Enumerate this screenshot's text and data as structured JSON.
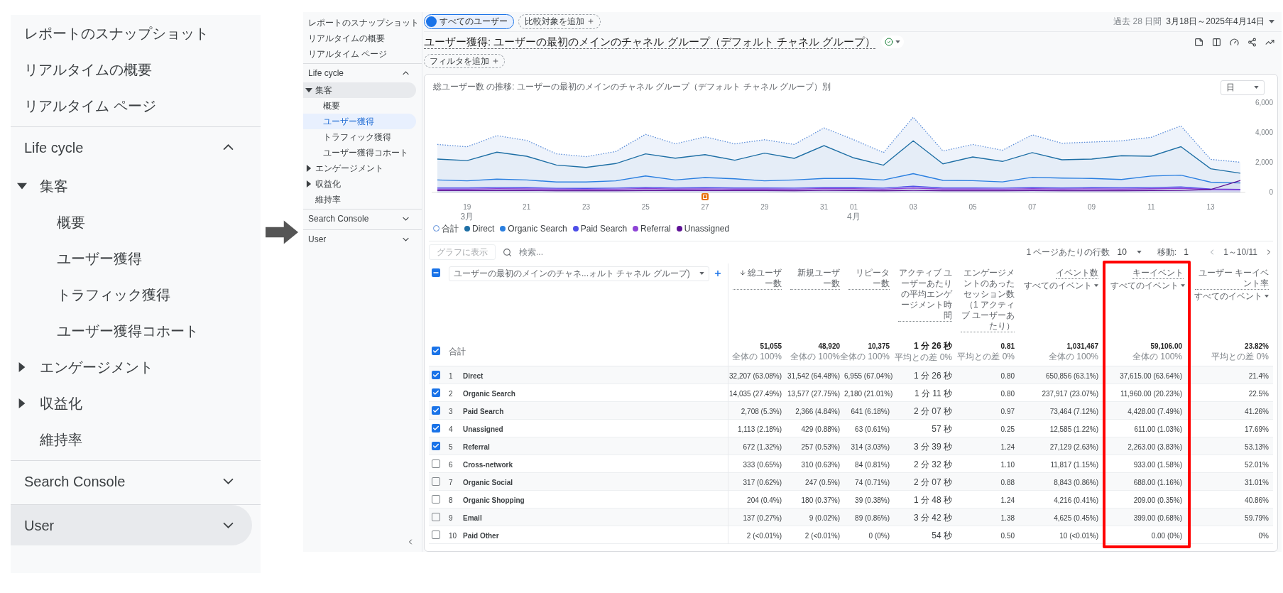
{
  "zoomed_sidebar": {
    "items": [
      {
        "kind": "link",
        "label": "レポートのスナップショット",
        "selected": false,
        "highlighted": false
      },
      {
        "kind": "link",
        "label": "リアルタイムの概要",
        "selected": false,
        "highlighted": false
      },
      {
        "kind": "link",
        "label": "リアルタイム ページ",
        "selected": false,
        "highlighted": false
      },
      {
        "kind": "section",
        "label": "Life cycle",
        "expanded": true,
        "selected": false,
        "highlighted": false,
        "children": [
          {
            "kind": "group",
            "label": "集客",
            "expanded": true,
            "selected": false,
            "highlighted": false,
            "children": [
              {
                "kind": "link",
                "label": "概要",
                "selected": false,
                "highlighted": false
              },
              {
                "kind": "link",
                "label": "ユーザー獲得",
                "selected": false,
                "highlighted": false
              },
              {
                "kind": "link",
                "label": "トラフィック獲得",
                "selected": false,
                "highlighted": false
              },
              {
                "kind": "link",
                "label": "ユーザー獲得コホート",
                "selected": false,
                "highlighted": false
              }
            ]
          },
          {
            "kind": "group",
            "label": "エンゲージメント",
            "expanded": false,
            "selected": false,
            "highlighted": false
          },
          {
            "kind": "group",
            "label": "収益化",
            "expanded": false,
            "selected": false,
            "highlighted": false
          },
          {
            "kind": "link",
            "label": "維持率",
            "selected": false,
            "highlighted": false
          }
        ]
      },
      {
        "kind": "section",
        "label": "Search Console",
        "expanded": false,
        "selected": false,
        "highlighted": false
      },
      {
        "kind": "section",
        "label": "User",
        "expanded": false,
        "selected": false,
        "highlighted": true
      }
    ]
  },
  "report": {
    "sidebar": {
      "items": [
        {
          "kind": "link",
          "label": "レポートのスナップショット",
          "selected": false,
          "highlighted": false
        },
        {
          "kind": "link",
          "label": "リアルタイムの概要",
          "selected": false,
          "highlighted": false
        },
        {
          "kind": "link",
          "label": "リアルタイム ページ",
          "selected": false,
          "highlighted": false
        },
        {
          "kind": "section",
          "label": "Life cycle",
          "expanded": true,
          "selected": false,
          "highlighted": false,
          "children": [
            {
              "kind": "group",
              "label": "集客",
              "expanded": true,
              "selected": false,
              "highlighted": true,
              "children": [
                {
                  "kind": "link",
                  "label": "概要",
                  "selected": false,
                  "highlighted": false
                },
                {
                  "kind": "link",
                  "label": "ユーザー獲得",
                  "selected": true
                },
                {
                  "kind": "link",
                  "label": "トラフィック獲得",
                  "selected": false,
                  "highlighted": false
                },
                {
                  "kind": "link",
                  "label": "ユーザー獲得コホート",
                  "selected": false,
                  "highlighted": false
                }
              ]
            },
            {
              "kind": "group",
              "label": "エンゲージメント",
              "expanded": false,
              "selected": false,
              "highlighted": false
            },
            {
              "kind": "group",
              "label": "収益化",
              "expanded": false,
              "selected": false,
              "highlighted": false
            },
            {
              "kind": "link",
              "label": "維持率",
              "selected": false,
              "highlighted": false
            }
          ]
        },
        {
          "kind": "section",
          "label": "Search Console",
          "expanded": false,
          "selected": false,
          "highlighted": false
        },
        {
          "kind": "section",
          "label": "User",
          "expanded": false,
          "selected": false,
          "highlighted": false
        }
      ]
    },
    "segment_chip": "すべてのユーザー",
    "compare_button": "比較対象を追加",
    "date_range": {
      "label": "過去 28 日間",
      "dates": "3月18日～2025年4月14日"
    },
    "title": "ユーザー獲得: ユーザーの最初のメインのチャネル グループ（デフォルト チャネル グループ）",
    "filter_button": "フィルタを追加",
    "chart_card": {
      "title": "総ユーザー数 の推移: ユーザーの最初のメインのチャネル グループ（デフォルト チャネル グループ）別",
      "interval": "日",
      "chart_data": {
        "type": "area",
        "categories": [
          null,
          "19",
          null,
          "21",
          null,
          "23",
          null,
          "25",
          null,
          "27",
          null,
          "29",
          null,
          "31",
          "01",
          null,
          "03",
          null,
          "05",
          null,
          "07",
          null,
          "09",
          null,
          "11",
          null,
          "13",
          null
        ],
        "series": [
          {
            "name": "合計",
            "line_style": "dotted",
            "color": "#5b8dd9",
            "values": [
              3220,
              3060,
              3810,
              3490,
              2590,
              2400,
              2750,
              3900,
              3260,
              3730,
              3260,
              3540,
              3220,
              4330,
              3540,
              2670,
              5050,
              2780,
              3220,
              2830,
              3860,
              3300,
              3380,
              3460,
              3700,
              4460,
              2220,
              2030
            ]
          },
          {
            "name": "Direct",
            "color": "#1e6fa5",
            "values": [
              2240,
              2140,
              2700,
              2430,
              1840,
              1680,
              1940,
              2590,
              2300,
              2540,
              2160,
              2640,
              2290,
              3140,
              2320,
              1830,
              3460,
              1920,
              2380,
              2080,
              2670,
              2190,
              2240,
              2460,
              2430,
              3070,
              1590,
              1290
            ]
          },
          {
            "name": "Organic Search",
            "color": "#2a7fe0",
            "values": [
              840,
              780,
              890,
              840,
              700,
              700,
              780,
              1110,
              840,
              1000,
              920,
              780,
              840,
              940,
              940,
              840,
              1260,
              810,
              790,
              710,
              1020,
              960,
              940,
              870,
              1100,
              1160,
              690,
              640
            ]
          },
          {
            "name": "Paid Search",
            "color": "#4d4fe8",
            "values": [
              300,
              300,
              330,
              320,
              280,
              270,
              290,
              340,
              300,
              320,
              300,
              300,
              290,
              330,
              320,
              290,
              420,
              300,
              300,
              290,
              330,
              300,
              320,
              310,
              330,
              370,
              230,
              210
            ]
          },
          {
            "name": "Referral",
            "color": "#8e44d6",
            "values": [
              220,
              220,
              250,
              240,
              220,
              210,
              220,
              260,
              230,
              240,
              230,
              230,
              220,
              260,
              250,
              220,
              300,
              230,
              230,
              220,
              250,
              230,
              240,
              230,
              250,
              280,
              200,
              180
            ]
          },
          {
            "name": "Unassigned",
            "color": "#5e1196",
            "values": [
              130,
              130,
              130,
              130,
              120,
              120,
              120,
              130,
              130,
              130,
              130,
              130,
              120,
              140,
              130,
              120,
              140,
              120,
              120,
              120,
              130,
              120,
              120,
              120,
              130,
              140,
              200,
              800
            ]
          }
        ],
        "ylim": [
          0,
          6000
        ],
        "yticks": [
          {
            "value": 0,
            "label": "0"
          },
          {
            "value": 2000,
            "label": "2,000"
          },
          {
            "value": 4000,
            "label": "4,000"
          },
          {
            "value": 6000,
            "label": "6,000"
          }
        ],
        "annotations": [
          "3月",
          "4月"
        ]
      }
    },
    "table": {
      "chart_button": {
        "label": "グラフに表示",
        "disabled": true
      },
      "search_placeholder": "検索...",
      "rows_per_page_label": "1 ページあたりの行数",
      "rows_per_page": "10",
      "goto_label": "移動:",
      "goto_value": "1",
      "page_range": "1～10/11",
      "select_all_partial": true,
      "dimension": "ユーザーの最初のメインのチャネ...ォルト チャネル グループ)",
      "columns": [
        {
          "label": "総ユーザー数",
          "kind": "number",
          "sorted": true,
          "highlighted": false
        },
        {
          "label": "新規ユーザー数",
          "kind": "number",
          "sorted": false,
          "highlighted": false
        },
        {
          "label": "リピーター数",
          "kind": "number",
          "sorted": false,
          "highlighted": false
        },
        {
          "label": "アクティブ ユーザーあたりの平均エンゲージメント時間",
          "kind": "duration",
          "sorted": false,
          "highlighted": false
        },
        {
          "label": "エンゲージメントのあったセッション数（1 アクティブ ユーザーあたり）",
          "kind": "number",
          "sorted": false,
          "highlighted": false
        },
        {
          "label": "イベント数",
          "sub": "すべてのイベント",
          "kind": "number",
          "sorted": false,
          "highlighted": false
        },
        {
          "label": "キーイベント",
          "sub": "すべてのイベント",
          "kind": "number",
          "sorted": false,
          "highlighted": true
        },
        {
          "label": "ユーザー キーイベント率",
          "sub": "すべてのイベント",
          "kind": "number",
          "sorted": false,
          "highlighted": false
        }
      ],
      "totals": {
        "checked": true,
        "label": "合計",
        "cells": [
          {
            "value": "51,055",
            "note": "全体の 100%"
          },
          {
            "value": "48,920",
            "note": "全体の 100%"
          },
          {
            "value": "10,375",
            "note": "全体の 100%"
          },
          {
            "value": "1 分 26 秒",
            "note": "平均との差 0%"
          },
          {
            "value": "0.81",
            "note": "平均との差 0%"
          },
          {
            "value": "1,031,467",
            "note": "全体の 100%"
          },
          {
            "value": "59,106.00",
            "note": "全体の 100%"
          },
          {
            "value": "23.82%",
            "note": "平均との差 0%"
          }
        ]
      },
      "rows": [
        {
          "checked": true,
          "index": "1",
          "name": "Direct",
          "cells": [
            "32,207 (63.08%)",
            "31,542 (64.48%)",
            "6,955 (67.04%)",
            "1 分 26 秒",
            "0.80",
            "650,856 (63.1%)",
            "37,615.00 (63.64%)",
            "21.4%"
          ]
        },
        {
          "checked": true,
          "index": "2",
          "name": "Organic Search",
          "cells": [
            "14,035 (27.49%)",
            "13,577 (27.75%)",
            "2,180 (21.01%)",
            "1 分 11 秒",
            "0.80",
            "237,917 (23.07%)",
            "11,960.00 (20.23%)",
            "22.5%"
          ]
        },
        {
          "checked": true,
          "index": "3",
          "name": "Paid Search",
          "cells": [
            "2,708 (5.3%)",
            "2,366 (4.84%)",
            "641 (6.18%)",
            "2 分 07 秒",
            "0.97",
            "73,464 (7.12%)",
            "4,428.00 (7.49%)",
            "41.26%"
          ]
        },
        {
          "checked": true,
          "index": "4",
          "name": "Unassigned",
          "cells": [
            "1,113 (2.18%)",
            "429 (0.88%)",
            "63 (0.61%)",
            "57 秒",
            "0.25",
            "12,585 (1.22%)",
            "611.00 (1.03%)",
            "17.69%"
          ]
        },
        {
          "checked": true,
          "index": "5",
          "name": "Referral",
          "cells": [
            "672 (1.32%)",
            "257 (0.53%)",
            "314 (3.03%)",
            "3 分 39 秒",
            "1.24",
            "27,129 (2.63%)",
            "2,263.00 (3.83%)",
            "53.13%"
          ]
        },
        {
          "checked": false,
          "index": "6",
          "name": "Cross-network",
          "cells": [
            "333 (0.65%)",
            "310 (0.63%)",
            "84 (0.81%)",
            "2 分 32 秒",
            "1.10",
            "11,817 (1.15%)",
            "933.00 (1.58%)",
            "52.01%"
          ]
        },
        {
          "checked": false,
          "index": "7",
          "name": "Organic Social",
          "cells": [
            "317 (0.62%)",
            "247 (0.5%)",
            "74 (0.71%)",
            "2 分 07 秒",
            "0.88",
            "8,843 (0.86%)",
            "688.00 (1.16%)",
            "31.01%"
          ]
        },
        {
          "checked": false,
          "index": "8",
          "name": "Organic Shopping",
          "cells": [
            "204 (0.4%)",
            "180 (0.37%)",
            "39 (0.38%)",
            "1 分 48 秒",
            "1.24",
            "4,216 (0.41%)",
            "209.00 (0.35%)",
            "40.86%"
          ]
        },
        {
          "checked": false,
          "index": "9",
          "name": "Email",
          "cells": [
            "137 (0.27%)",
            "9 (0.02%)",
            "89 (0.86%)",
            "3 分 42 秒",
            "1.38",
            "4,625 (0.45%)",
            "399.00 (0.68%)",
            "59.79%"
          ]
        },
        {
          "checked": false,
          "index": "10",
          "name": "Paid Other",
          "cells": [
            "2 (<0.01%)",
            "2 (<0.01%)",
            "0 (0%)",
            "54 秒",
            "0.50",
            "10 (<0.01%)",
            "0.00 (0%)",
            "0%"
          ]
        }
      ]
    }
  }
}
